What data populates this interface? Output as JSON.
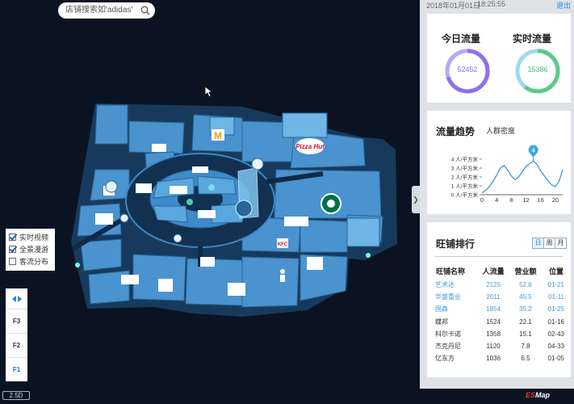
{
  "search": {
    "placeholder": "店铺搜索如'adidas'"
  },
  "layers": [
    {
      "label": "实时视频",
      "checked": true
    },
    {
      "label": "全景漫游",
      "checked": true
    },
    {
      "label": "客流分布",
      "checked": false
    }
  ],
  "floors": [
    "F3",
    "F2",
    "F1"
  ],
  "active_floor": "F1",
  "view_mode": "2.5D",
  "topbar": {
    "date": "2018年01月01日",
    "time": "18:25:55",
    "exit": "退出"
  },
  "gauges": [
    {
      "title": "今日流量",
      "value": "52452",
      "color": "#8e6ff0"
    },
    {
      "title": "实时流量",
      "value": "15386",
      "color": "#5cc98a"
    }
  ],
  "trend": {
    "title": "流量趋势",
    "subtitle": "人群密度",
    "tooltip": "4"
  },
  "chart_data": {
    "type": "line",
    "title": "流量趋势",
    "ylabel": "人群密度",
    "x_ticks": [
      "0",
      "4",
      "8",
      "12",
      "16",
      "20"
    ],
    "y_ticks": [
      "0 人/平方米",
      "1 人/平方米",
      "2 人/平方米",
      "3 人/平方米",
      "4 人/平方米"
    ],
    "ylim": [
      0,
      4
    ],
    "xlim": [
      0,
      22
    ],
    "x": [
      0,
      1,
      2,
      3,
      4,
      5,
      6,
      7,
      8,
      9,
      10,
      11,
      12,
      13,
      14,
      15,
      16,
      17,
      18,
      19,
      20,
      21,
      22
    ],
    "values": [
      0.2,
      0.5,
      0.9,
      1.5,
      2.2,
      3.0,
      3.3,
      2.8,
      2.1,
      1.7,
      2.0,
      2.6,
      3.2,
      3.5,
      3.8,
      3.4,
      2.7,
      2.1,
      1.6,
      1.1,
      0.9,
      1.5,
      2.8
    ],
    "highlight": {
      "x": 14,
      "y": 4
    },
    "grid": false
  },
  "ranking": {
    "title": "旺铺排行",
    "tabs": [
      "日",
      "周",
      "月"
    ],
    "headers": [
      "旺铺名称",
      "人流量",
      "营业额",
      "位置"
    ],
    "rows": [
      [
        "艺术达",
        "2125",
        "52.6",
        "01-21"
      ],
      [
        "华盛重业",
        "2011",
        "45.5",
        "01-11"
      ],
      [
        "国森",
        "1854",
        "35.2",
        "01-25"
      ],
      [
        "蝶邦",
        "1524",
        "22.1",
        "01-16"
      ],
      [
        "科尔卡诺",
        "1358",
        "15.1",
        "02-43"
      ],
      [
        "杰克丹尼",
        "1120",
        "7.8",
        "04-33"
      ],
      [
        "忆东方",
        "1036",
        "6.5",
        "01-05"
      ]
    ],
    "highlight_rows": 3
  },
  "logo": {
    "prefix": "ES",
    "suffix": "Map"
  },
  "brand_signs": [
    "Pizza Hut",
    "M",
    "STARBUCKS",
    "KFC"
  ]
}
